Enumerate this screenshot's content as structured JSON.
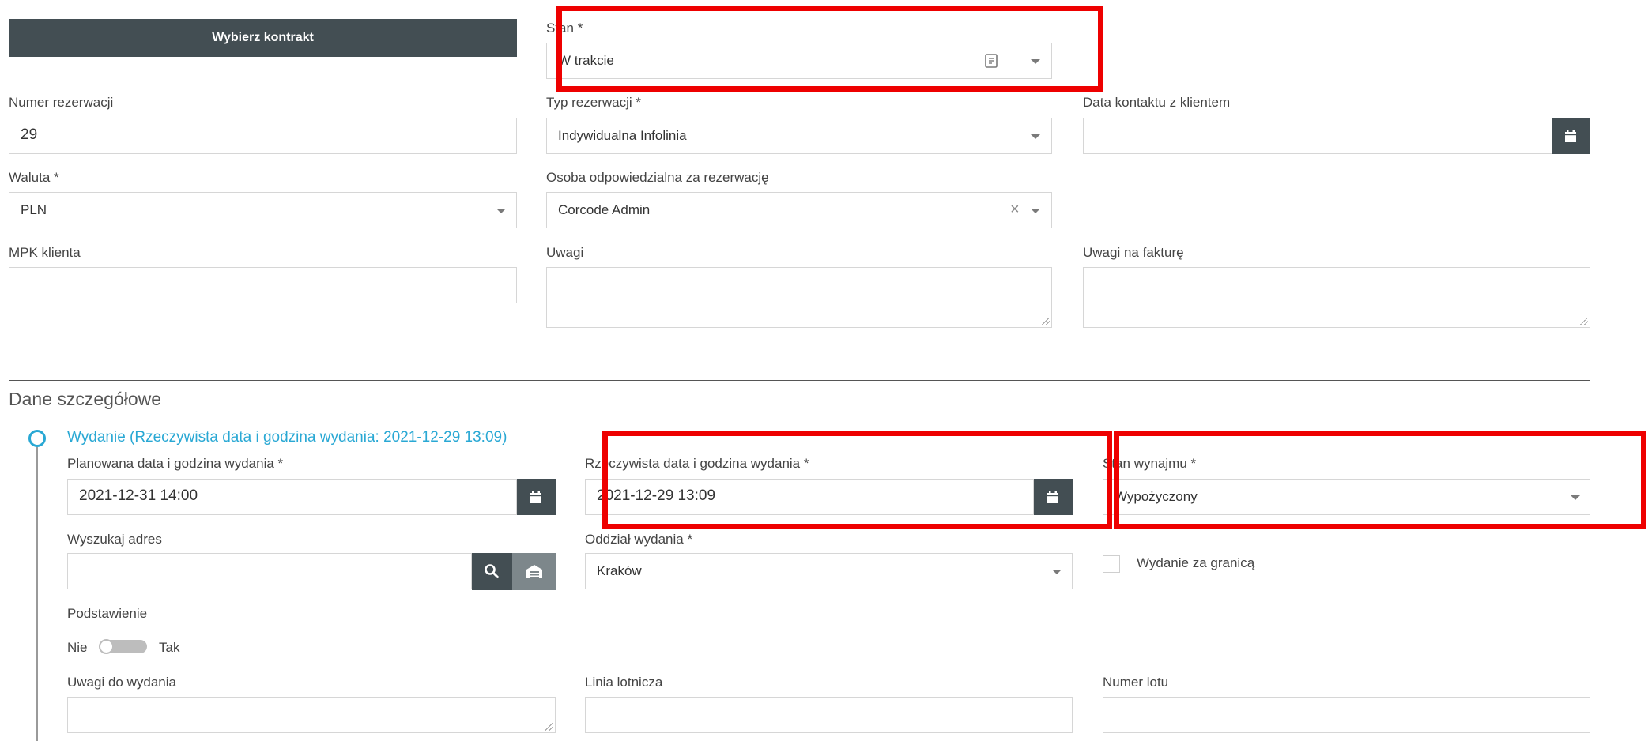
{
  "top": {
    "choose_contract_button": "Wybierz kontrakt",
    "status_label": "Stan *",
    "status_value": "W trakcie"
  },
  "fields": {
    "reservation_number_label": "Numer rezerwacji",
    "reservation_number_value": "29",
    "reservation_type_label": "Typ rezerwacji *",
    "reservation_type_value": "Indywidualna Infolinia",
    "contact_date_label": "Data kontaktu z klientem",
    "contact_date_value": "",
    "currency_label": "Waluta *",
    "currency_value": "PLN",
    "responsible_person_label": "Osoba odpowiedzialna za rezerwację",
    "responsible_person_value": "Corcode Admin",
    "client_mpk_label": "MPK klienta",
    "client_mpk_value": "",
    "notes_label": "Uwagi",
    "invoice_notes_label": "Uwagi na fakturę"
  },
  "details": {
    "section_title": "Dane szczegółowe",
    "step_title": "Wydanie (Rzeczywista data i godzina wydania: 2021-12-29 13:09)",
    "planned_datetime_label": "Planowana data i godzina wydania *",
    "planned_datetime_value": "2021-12-31 14:00",
    "actual_datetime_label": "Rzeczywista data i godzina wydania *",
    "actual_datetime_value": "2021-12-29 13:09",
    "rental_status_label": "Stan wynajmu *",
    "rental_status_value": "Wypożyczony",
    "search_address_label": "Wyszukaj adres",
    "search_address_value": "",
    "release_branch_label": "Oddział wydania *",
    "release_branch_value": "Kraków",
    "abroad_checkbox_label": "Wydanie za granicą",
    "substitution_label": "Podstawienie",
    "toggle_off_label": "Nie",
    "toggle_on_label": "Tak",
    "release_notes_label": "Uwagi do wydania",
    "airline_label": "Linia lotnicza",
    "flight_number_label": "Numer lotu"
  },
  "colors": {
    "dark_button": "#434e53",
    "accent": "#29a8d4",
    "highlight": "#ee0000"
  }
}
